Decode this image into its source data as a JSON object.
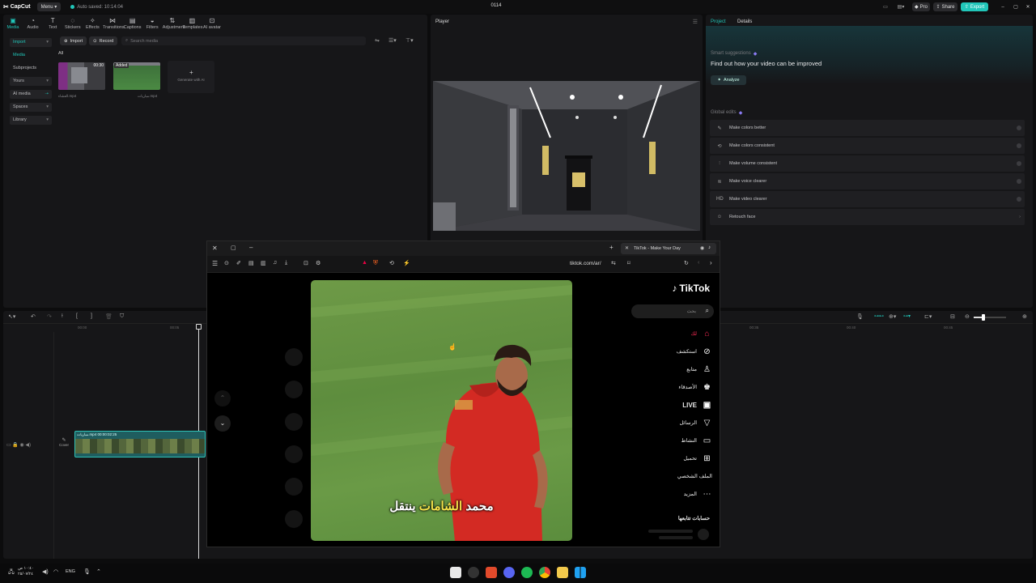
{
  "app": {
    "logo": "CapCut",
    "menu": "Menu",
    "autosave": "Auto saved: 10:14:04",
    "title": "0114",
    "pro": "Pro",
    "share": "Share",
    "export": "Export",
    "accent": "#21c6b9"
  },
  "toolbar": [
    {
      "label": "Media",
      "icon": "media-icon",
      "glyph": "▣",
      "active": true
    },
    {
      "label": "Audio",
      "icon": "audio-icon",
      "glyph": "◔"
    },
    {
      "label": "Text",
      "icon": "text-icon",
      "glyph": "T"
    },
    {
      "label": "Stickers",
      "icon": "stickers-icon",
      "glyph": "◌"
    },
    {
      "label": "Effects",
      "icon": "effects-icon",
      "glyph": "✧"
    },
    {
      "label": "Transitions",
      "icon": "transitions-icon",
      "glyph": "⋈"
    },
    {
      "label": "Captions",
      "icon": "captions-icon",
      "glyph": "▤"
    },
    {
      "label": "Filters",
      "icon": "filters-icon",
      "glyph": "◒"
    },
    {
      "label": "Adjustment",
      "icon": "adjustment-icon",
      "glyph": "⇅"
    },
    {
      "label": "Templates",
      "icon": "templates-icon",
      "glyph": "▥"
    },
    {
      "label": "AI avatar",
      "icon": "ai-avatar-icon",
      "glyph": "⊡"
    }
  ],
  "sidebar": [
    {
      "label": "Import",
      "active": true
    },
    {
      "label": "Media",
      "active": true
    },
    {
      "label": "Subprojects"
    },
    {
      "label": "Yours"
    },
    {
      "label": "AI media"
    },
    {
      "label": "Spaces"
    },
    {
      "label": "Library"
    }
  ],
  "media": {
    "import": "Import",
    "record": "Record",
    "search_placeholder": "Search media",
    "filter_all": "All",
    "clip1_time": "00:30",
    "clip1_name": "العشاء.mp4",
    "clip2_badge": "Added",
    "clip2_name": "مباريات.mp4",
    "generate": "Generate with AI"
  },
  "player": {
    "title": "Player"
  },
  "details": {
    "tab_project": "Project",
    "tab_details": "Details",
    "smart_title": "Smart suggestions",
    "smart_sub": "Find out how your video can be improved",
    "analyze": "Analyze",
    "global_title": "Global edits",
    "edits": [
      {
        "label": "Make colors better",
        "icon": "color-brush-icon",
        "glyph": "✎"
      },
      {
        "label": "Make colors consistent",
        "icon": "color-consistent-icon",
        "glyph": "⟲"
      },
      {
        "label": "Make volume consistent",
        "icon": "volume-icon",
        "glyph": "⫶"
      },
      {
        "label": "Make voice clearer",
        "icon": "voice-icon",
        "glyph": "≋"
      },
      {
        "label": "Make video clearer",
        "icon": "hd-icon",
        "glyph": "HD"
      },
      {
        "label": "Retouch face",
        "icon": "retouch-icon",
        "glyph": "☺"
      }
    ]
  },
  "timeline": {
    "t0": "00:00",
    "t1": "00:05",
    "t2": "00:35",
    "t3": "00:40",
    "t4": "00:45",
    "clip_label": "مباريات.mp4 00:00:02:25",
    "cover": "Cover"
  },
  "browser": {
    "tab_title": "TikTok - Make Your Day",
    "url": "tiktok.com/ar/"
  },
  "tiktok": {
    "logo": "TikTok",
    "search_placeholder": "بحث",
    "caption_white1": "محمد",
    "caption_yellow": "الشامات",
    "caption_white2": "ينتقل",
    "nav": [
      {
        "label": "لك",
        "icon": "home-icon",
        "glyph": "⌂",
        "active": true
      },
      {
        "label": "استكشف",
        "icon": "explore-icon",
        "glyph": "⊘"
      },
      {
        "label": "متابع",
        "icon": "following-icon",
        "glyph": "♙"
      },
      {
        "label": "الأصدقاء",
        "icon": "friends-icon",
        "glyph": "♚"
      },
      {
        "label": "LIVE",
        "icon": "live-icon",
        "glyph": "▣"
      },
      {
        "label": "الرسائل",
        "icon": "messages-icon",
        "glyph": "▽"
      },
      {
        "label": "النشاط",
        "icon": "activity-icon",
        "glyph": "▭"
      },
      {
        "label": "تحميل",
        "icon": "upload-icon",
        "glyph": "⊞"
      },
      {
        "label": "الملف الشخصي",
        "icon": "profile-icon",
        "glyph": ""
      },
      {
        "label": "المزيد",
        "icon": "more-icon",
        "glyph": "⋯"
      }
    ],
    "following_title": "حسابات تتابعها"
  },
  "taskbar": {
    "lang": "ENG",
    "time": "١٠:٤٠ ص",
    "date": "٢٥/٠٧/٢٤"
  }
}
